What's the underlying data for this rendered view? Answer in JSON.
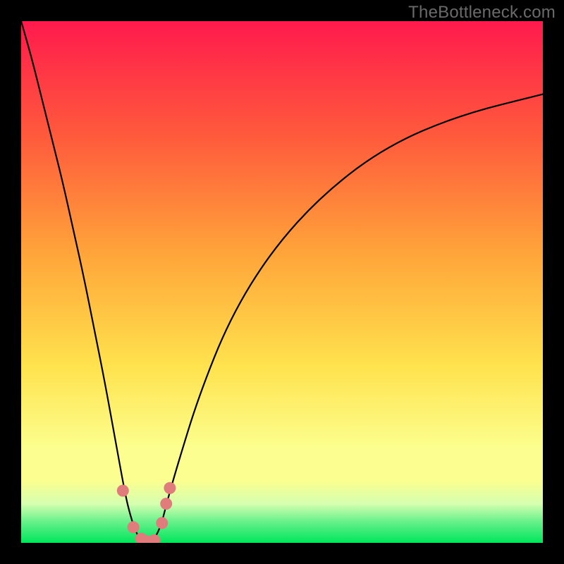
{
  "watermark": "TheBottleneck.com",
  "colors": {
    "frame": "#000000",
    "grad_top": "#ff1a4d",
    "grad_mid1": "#ff6f3c",
    "grad_mid2": "#ffb33c",
    "grad_mid3": "#ffe24d",
    "grad_yellowband": "#fcff8f",
    "grad_palegreen": "#b3ffab",
    "grad_green": "#00e65c",
    "curve": "#000000",
    "marker": "#e07c7c"
  },
  "chart_data": {
    "type": "line",
    "title": "",
    "xlabel": "",
    "ylabel": "",
    "xlim": [
      0,
      100
    ],
    "ylim": [
      0,
      100
    ],
    "series": [
      {
        "name": "bottleneck-curve",
        "x": [
          0,
          2,
          4,
          6,
          8,
          10,
          12,
          14,
          16,
          18,
          20,
          21,
          22,
          23,
          24,
          25,
          26,
          27,
          28,
          30,
          34,
          40,
          48,
          58,
          70,
          84,
          100
        ],
        "y": [
          100,
          93,
          85,
          77,
          69,
          60,
          51,
          41,
          31,
          20,
          9,
          5,
          2,
          0.5,
          0,
          0.3,
          1.5,
          4,
          8,
          15,
          28,
          43,
          56,
          67,
          76,
          82,
          86
        ]
      }
    ],
    "markers": [
      {
        "x": 19.5,
        "y": 10
      },
      {
        "x": 21.5,
        "y": 3
      },
      {
        "x": 23.0,
        "y": 0.8
      },
      {
        "x": 24.0,
        "y": 0.3
      },
      {
        "x": 25.5,
        "y": 0.5
      },
      {
        "x": 27.0,
        "y": 3.8
      },
      {
        "x": 27.8,
        "y": 7.5
      },
      {
        "x": 28.5,
        "y": 10.5
      }
    ]
  }
}
